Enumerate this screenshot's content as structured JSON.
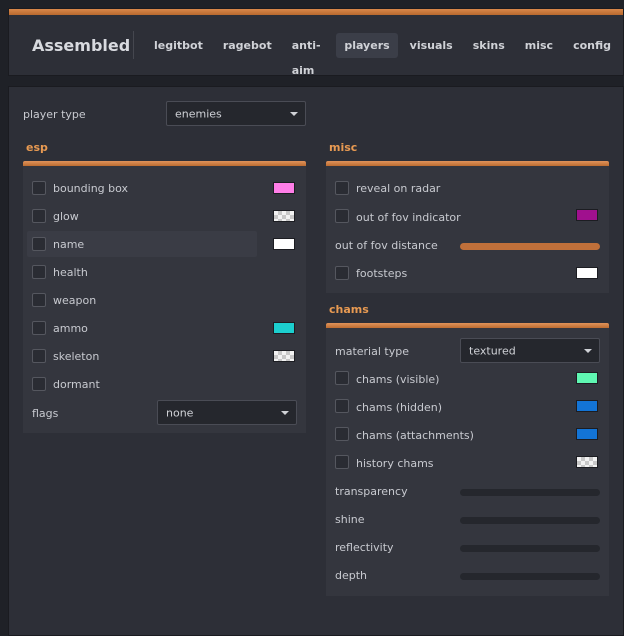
{
  "app": {
    "title": "Assembled"
  },
  "tabs": [
    {
      "label": "legitbot",
      "active": false
    },
    {
      "label": "ragebot",
      "active": false
    },
    {
      "label": "anti-aim",
      "active": false
    },
    {
      "label": "players",
      "active": true
    },
    {
      "label": "visuals",
      "active": false
    },
    {
      "label": "skins",
      "active": false
    },
    {
      "label": "misc",
      "active": false
    },
    {
      "label": "config",
      "active": false
    }
  ],
  "player_type": {
    "label": "player type",
    "value": "enemies"
  },
  "esp": {
    "title": "esp",
    "items": [
      {
        "label": "bounding box",
        "checked": false,
        "color": "#ff7ee8"
      },
      {
        "label": "glow",
        "checked": false,
        "color": "checker"
      },
      {
        "label": "name",
        "checked": false,
        "color": "#ffffff"
      },
      {
        "label": "health",
        "checked": false,
        "color": ""
      },
      {
        "label": "weapon",
        "checked": false,
        "color": ""
      },
      {
        "label": "ammo",
        "checked": false,
        "color": "#1ccfcf"
      },
      {
        "label": "skeleton",
        "checked": false,
        "color": "checker"
      },
      {
        "label": "dormant",
        "checked": false,
        "color": ""
      }
    ],
    "flags": {
      "label": "flags",
      "value": "none"
    }
  },
  "misc": {
    "title": "misc",
    "reveal": {
      "label": "reveal on radar",
      "checked": false
    },
    "fov_indicator": {
      "label": "out of fov indicator",
      "checked": false,
      "color": "#a0108e"
    },
    "fov_distance": {
      "label": "out of fov distance",
      "value": 1.0
    },
    "footsteps": {
      "label": "footsteps",
      "checked": false,
      "color": "#ffffff"
    }
  },
  "chams": {
    "title": "chams",
    "material": {
      "label": "material type",
      "value": "textured"
    },
    "items": [
      {
        "label": "chams (visible)",
        "checked": false,
        "color": "#5ff7b2"
      },
      {
        "label": "chams (hidden)",
        "checked": false,
        "color": "#1374d6"
      },
      {
        "label": "chams (attachments)",
        "checked": false,
        "color": "#1374d6"
      },
      {
        "label": "history chams",
        "checked": false,
        "color": "checker"
      }
    ],
    "sliders": [
      {
        "label": "transparency",
        "value": 0
      },
      {
        "label": "shine",
        "value": 0
      },
      {
        "label": "reflectivity",
        "value": 0
      },
      {
        "label": "depth",
        "value": 0
      }
    ]
  }
}
